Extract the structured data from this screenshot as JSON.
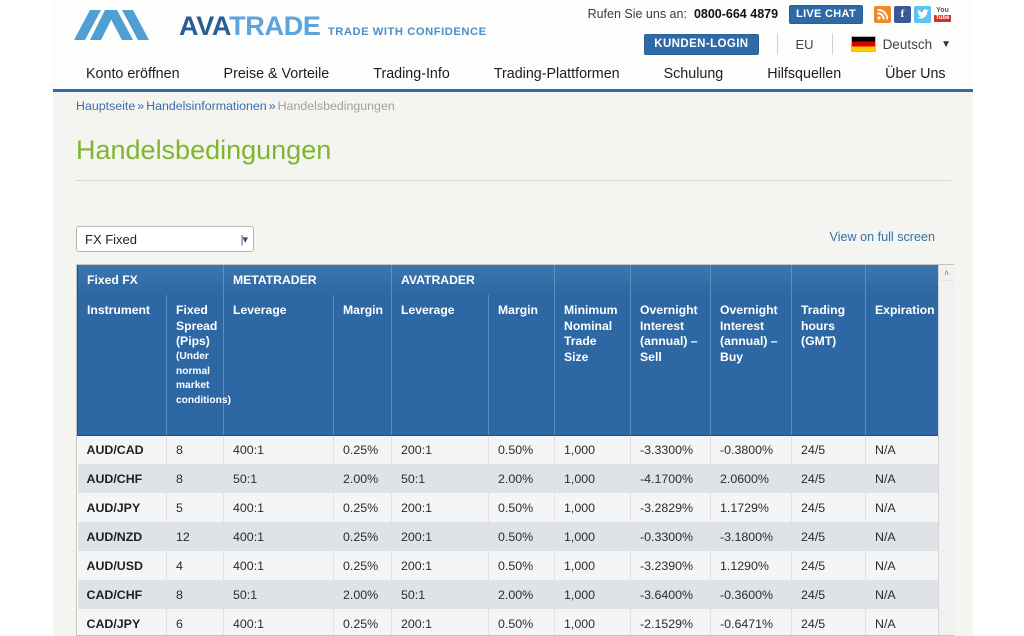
{
  "brand": {
    "name_part1": "AVA",
    "name_part2": "TRADE",
    "tagline": "TRADE WITH CONFIDENCE",
    "logo_icon": "ava-chevrons-logo",
    "accent_blue": "#2f6aa8",
    "accent_green": "#7fb62e"
  },
  "header": {
    "call_label": "Rufen Sie uns an:",
    "call_number": "0800-664 4879",
    "live_chat_label": "LIVE CHAT",
    "social": [
      {
        "name": "rss-icon",
        "label": "RSS",
        "color": "#f08a24"
      },
      {
        "name": "facebook-icon",
        "label": "f",
        "color": "#3b5998"
      },
      {
        "name": "twitter-icon",
        "label": "t",
        "color": "#5bc4f1"
      },
      {
        "name": "youtube-icon",
        "label_top": "You",
        "label_bottom": "Tube",
        "color": "#d32f2f"
      }
    ],
    "login_label": "KUNDEN-LOGIN",
    "region": "EU",
    "language": "Deutsch",
    "language_flag": "germany-flag-icon",
    "language_caret": "▼"
  },
  "nav": {
    "items": [
      {
        "label": "Konto eröffnen",
        "name": "nav-konto-eroeffnen"
      },
      {
        "label": "Preise & Vorteile",
        "name": "nav-preise-vorteile"
      },
      {
        "label": "Trading-Info",
        "name": "nav-trading-info"
      },
      {
        "label": "Trading-Plattformen",
        "name": "nav-trading-plattformen"
      },
      {
        "label": "Schulung",
        "name": "nav-schulung"
      },
      {
        "label": "Hilfsquellen",
        "name": "nav-hilfsquellen"
      },
      {
        "label": "Über Uns",
        "name": "nav-ueber-uns"
      }
    ]
  },
  "breadcrumb": {
    "home": "Hauptseite",
    "sep": "»",
    "section": "Handelsinformationen",
    "current": "Handelsbedingungen"
  },
  "page": {
    "title": "Handelsbedingungen"
  },
  "controls": {
    "select_value": "FX Fixed",
    "select_arrow": "|▾",
    "fullscreen_link": "View on full screen"
  },
  "table": {
    "group_headers": [
      {
        "label": "Fixed FX",
        "span": 2
      },
      {
        "label": "METATRADER",
        "span": 2
      },
      {
        "label": "AVATRADER",
        "span": 2
      },
      {
        "label": "",
        "span": 1
      },
      {
        "label": "",
        "span": 1
      },
      {
        "label": "",
        "span": 1
      },
      {
        "label": "",
        "span": 1
      },
      {
        "label": "",
        "span": 1
      }
    ],
    "columns": [
      {
        "label": "Instrument",
        "small": ""
      },
      {
        "label": "Fixed Spread (Pips)",
        "small": "(Under normal market conditions)"
      },
      {
        "label": "Leverage",
        "small": ""
      },
      {
        "label": "Margin",
        "small": ""
      },
      {
        "label": "Leverage",
        "small": ""
      },
      {
        "label": "Margin",
        "small": ""
      },
      {
        "label": "Minimum Nominal Trade Size",
        "small": ""
      },
      {
        "label": "Overnight Interest (annual) – Sell",
        "small": ""
      },
      {
        "label": "Overnight Interest (annual) – Buy",
        "small": ""
      },
      {
        "label": "Trading hours (GMT)",
        "small": ""
      },
      {
        "label": "Expiration",
        "small": ""
      }
    ],
    "rows": [
      [
        "AUD/CAD",
        "8",
        "400:1",
        "0.25%",
        "200:1",
        "0.50%",
        "1,000",
        "-3.3300%",
        "-0.3800%",
        "24/5",
        "N/A"
      ],
      [
        "AUD/CHF",
        "8",
        "50:1",
        "2.00%",
        "50:1",
        "2.00%",
        "1,000",
        "-4.1700%",
        "2.0600%",
        "24/5",
        "N/A"
      ],
      [
        "AUD/JPY",
        "5",
        "400:1",
        "0.25%",
        "200:1",
        "0.50%",
        "1,000",
        "-3.2829%",
        "1.1729%",
        "24/5",
        "N/A"
      ],
      [
        "AUD/NZD",
        "12",
        "400:1",
        "0.25%",
        "200:1",
        "0.50%",
        "1,000",
        "-0.3300%",
        "-3.1800%",
        "24/5",
        "N/A"
      ],
      [
        "AUD/USD",
        "4",
        "400:1",
        "0.25%",
        "200:1",
        "0.50%",
        "1,000",
        "-3.2390%",
        "1.1290%",
        "24/5",
        "N/A"
      ],
      [
        "CAD/CHF",
        "8",
        "50:1",
        "2.00%",
        "50:1",
        "2.00%",
        "1,000",
        "-3.6400%",
        "-0.3600%",
        "24/5",
        "N/A"
      ],
      [
        "CAD/JPY",
        "6",
        "400:1",
        "0.25%",
        "200:1",
        "0.50%",
        "1,000",
        "-2.1529%",
        "-0.6471%",
        "24/5",
        "N/A"
      ]
    ],
    "scroll_up_glyph": "∧"
  }
}
